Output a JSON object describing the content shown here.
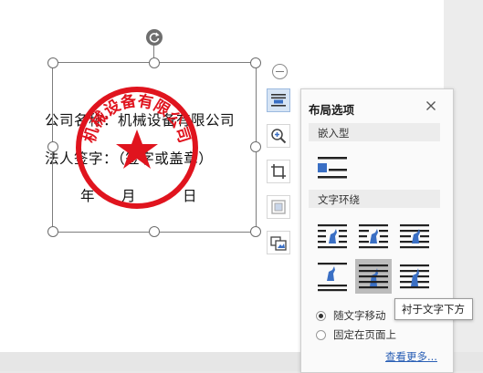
{
  "document": {
    "line1": "公司名称：机械设备有限公司",
    "line2": "法人签字：（签字或盖章）",
    "date_year": "年",
    "date_month": "月",
    "date_day": "日"
  },
  "seal": {
    "arc_text": "机械设备有限公司",
    "color": "#e0141e"
  },
  "toolbar": {
    "items": [
      "layout-options",
      "zoom-in",
      "crop",
      "fill-frame",
      "change-picture"
    ]
  },
  "layout_panel": {
    "title": "布局选项",
    "inline_section": "嵌入型",
    "wrap_section": "文字环绕",
    "options": [
      "随文字移动",
      "固定在页面上"
    ],
    "selected_option": "随文字移动",
    "more_link": "查看更多..."
  },
  "tooltip": {
    "text": "衬于文字下方"
  },
  "colors": {
    "accent": "#3a6fc4",
    "selected_tile": "#bcbcbc"
  }
}
